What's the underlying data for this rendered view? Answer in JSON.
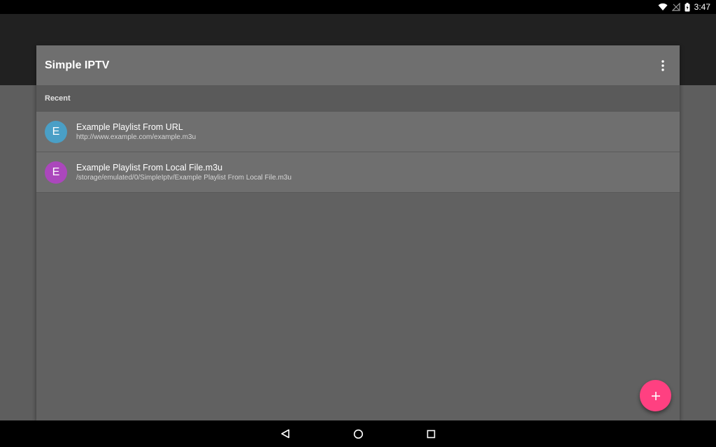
{
  "status_bar": {
    "time": "3:47",
    "icons": [
      "wifi-icon",
      "signal-icon",
      "battery-charging-icon"
    ]
  },
  "app": {
    "title": "Simple IPTV",
    "menu_icon": "more-vert-icon"
  },
  "list": {
    "section_header": "Recent",
    "items": [
      {
        "avatar_letter": "E",
        "avatar_color": "#4a9fc6",
        "title": "Example Playlist From URL",
        "subtitle": "http://www.example.com/example.m3u"
      },
      {
        "avatar_letter": "E",
        "avatar_color": "#ab47bc",
        "title": "Example Playlist From Local File.m3u",
        "subtitle": "/storage/emulated/0/SimpleIptv/Example Playlist From Local File.m3u"
      }
    ]
  },
  "fab": {
    "icon": "add-icon",
    "color": "#ff4081"
  },
  "nav_bar": {
    "buttons": [
      "back-icon",
      "home-icon",
      "recents-icon"
    ]
  }
}
